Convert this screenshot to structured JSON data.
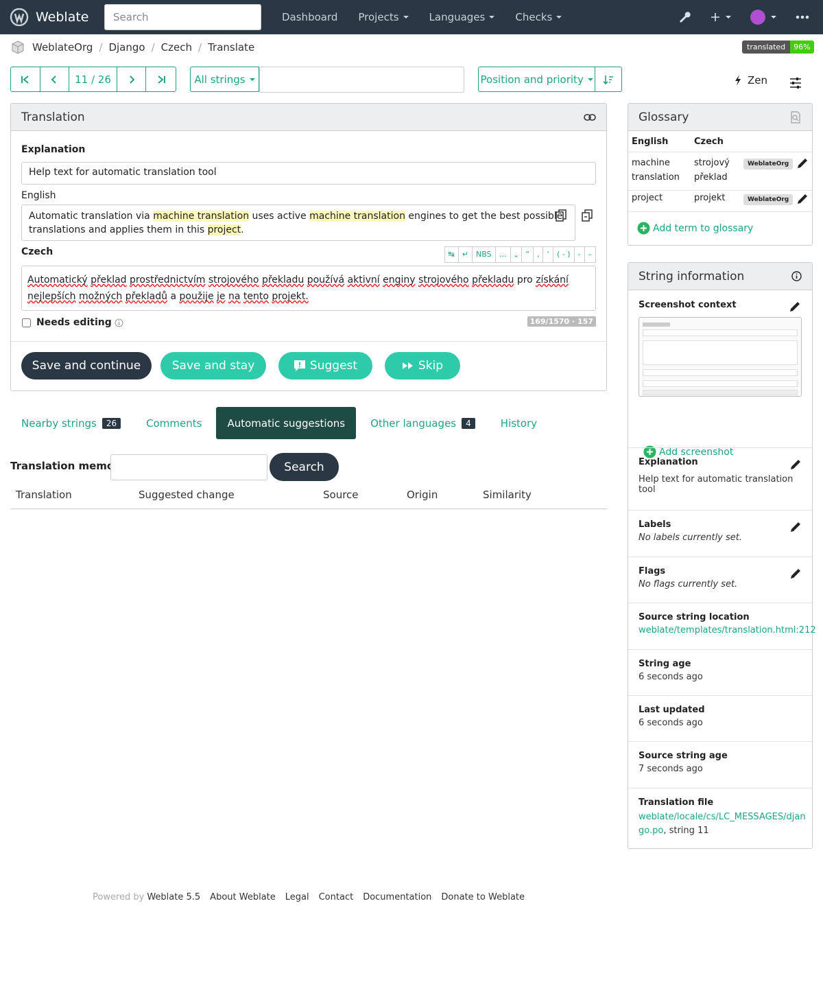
{
  "navbar": {
    "brand": "Weblate",
    "search_placeholder": "Search",
    "links": [
      "Dashboard",
      "Projects",
      "Languages",
      "Checks"
    ],
    "icons": [
      "wrench-icon",
      "plus-icon",
      "avatar",
      "more-icon"
    ]
  },
  "breadcrumb": [
    "WeblateOrg",
    "Django",
    "Czech",
    "Translate"
  ],
  "translated_badge": {
    "label": "translated",
    "value": "96%",
    "color": "#44cc11"
  },
  "toolbar": {
    "position": "11 / 26",
    "filter": "All strings",
    "sort": "Position and priority",
    "zen": "Zen"
  },
  "translation": {
    "title": "Translation",
    "explanation_label": "Explanation",
    "explanation": "Help text for automatic translation tool",
    "source_lang": "English",
    "source_parts": [
      "Automatic translation via ",
      "machine translation",
      " uses active ",
      "machine translation",
      " engines to get the best possible translations and applies them in this ",
      "project",
      "."
    ],
    "target_lang": "Czech",
    "target_words": [
      "Automatický",
      "překlad",
      "prostřednictvím",
      "strojového",
      "překladu",
      "používá",
      "aktivní",
      "enginy",
      "strojového",
      "překladu",
      "pro",
      "získání",
      "nejlepších",
      "možných",
      "překladů",
      "a",
      "použije",
      "je",
      "na",
      "tento",
      "projekt."
    ],
    "special_chars": [
      "↹",
      "↵",
      "NBS",
      "…",
      "„",
      "“",
      ",",
      "‘",
      "( - )",
      "-",
      "–"
    ],
    "needs_editing": "Needs editing",
    "counter": "169/1570 · 157",
    "buttons": {
      "save_continue": "Save and continue",
      "save_stay": "Save and stay",
      "suggest": "Suggest",
      "skip": "Skip"
    }
  },
  "tabs": [
    {
      "label": "Nearby strings",
      "count": "26"
    },
    {
      "label": "Comments",
      "count": ""
    },
    {
      "label": "Automatic suggestions",
      "count": ""
    },
    {
      "label": "Other languages",
      "count": "4"
    },
    {
      "label": "History",
      "count": ""
    }
  ],
  "memory": {
    "label": "Translation memory",
    "search": "Search",
    "columns": [
      "Translation",
      "Suggested change",
      "Source",
      "Origin",
      "Similarity"
    ]
  },
  "glossary": {
    "title": "Glossary",
    "col_en": "English",
    "col_cs": "Czech",
    "rows": [
      {
        "en": "machine translation",
        "cs": "strojový překlad",
        "tag": "WeblateOrg"
      },
      {
        "en": "project",
        "cs": "projekt",
        "tag": "WeblateOrg"
      }
    ],
    "add": "Add term to glossary"
  },
  "info": {
    "title": "String information",
    "screenshot_context": "Screenshot context",
    "add_screenshot": "Add screenshot",
    "explanation_label": "Explanation",
    "explanation": "Help text for automatic translation tool",
    "labels_label": "Labels",
    "labels": "No labels currently set.",
    "flags_label": "Flags",
    "flags": "No flags currently set.",
    "location_label": "Source string location",
    "location": "weblate/templates/translation.html:212",
    "age_label": "String age",
    "age": "6 seconds ago",
    "updated_label": "Last updated",
    "updated": "6 seconds ago",
    "source_age_label": "Source string age",
    "source_age": "7 seconds ago",
    "file_label": "Translation file",
    "file": "weblate/locale/cs/LC_MESSAGES/django.po",
    "file_suffix": ", string 11"
  },
  "footer": {
    "powered": "Powered by",
    "version": "Weblate 5.5",
    "links": [
      "About Weblate",
      "Legal",
      "Contact",
      "Documentation",
      "Donate to Weblate"
    ]
  }
}
